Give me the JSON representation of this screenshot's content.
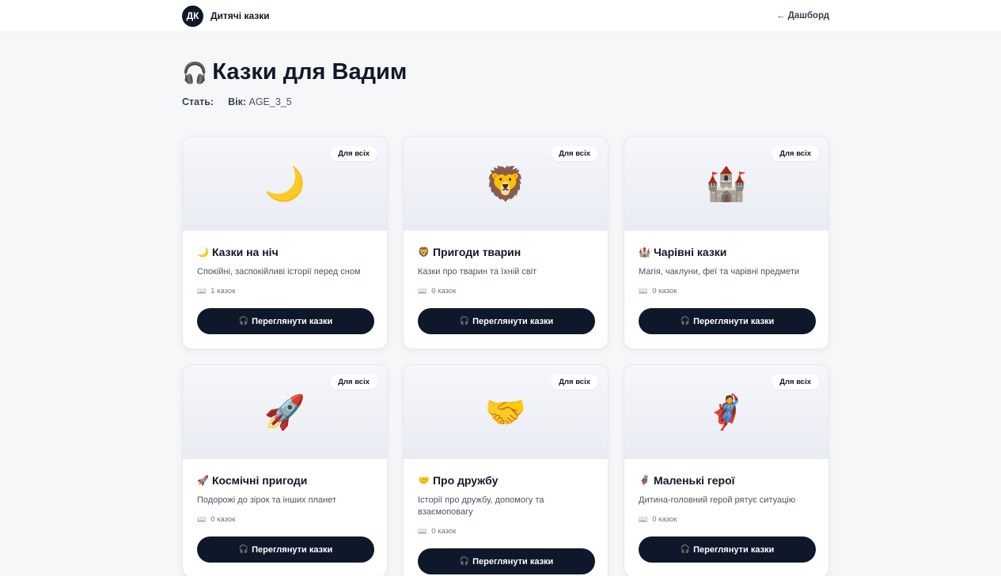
{
  "header": {
    "avatar_initials": "ДК",
    "brand_name": "Дитячі казки",
    "back_arrow": "←",
    "back_label": "Дашборд"
  },
  "page": {
    "title_icon": "🎧",
    "title": "Казки для Вадим",
    "gender_label": "Стать:",
    "gender_value": "",
    "age_label": "Вік:",
    "age_value": "AGE_3_5"
  },
  "button_icon": "🎧",
  "count_icon": "📖",
  "categories": [
    {
      "emoji": "🌙",
      "badge": "Для всіх",
      "title": "Казки на ніч",
      "description": "Спокійні, заспокійливі історії перед сном",
      "count": "1 казок",
      "button": "Переглянути казки"
    },
    {
      "emoji": "🦁",
      "badge": "Для всіх",
      "title": "Пригоди тварин",
      "description": "Казки про тварин та їхній світ",
      "count": "0 казок",
      "button": "Переглянути казки"
    },
    {
      "emoji": "🏰",
      "badge": "Для всіх",
      "title": "Чарівні казки",
      "description": "Магія, чаклуни, феї та чарівні предмети",
      "count": "0 казок",
      "button": "Переглянути казки"
    },
    {
      "emoji": "🚀",
      "badge": "Для всіх",
      "title": "Космічні пригоди",
      "description": "Подорожі до зірок та інших планет",
      "count": "0 казок",
      "button": "Переглянути казки"
    },
    {
      "emoji": "🤝",
      "badge": "Для всіх",
      "title": "Про дружбу",
      "description": "Історії про дружбу, допомогу та взаємоповагу",
      "count": "0 казок",
      "button": "Переглянути казки"
    },
    {
      "emoji": "🦸",
      "badge": "Для всіх",
      "title": "Маленькі герої",
      "description": "Дитина-головний герой рятує ситуацію",
      "count": "0 казок",
      "button": "Переглянути казки"
    }
  ]
}
